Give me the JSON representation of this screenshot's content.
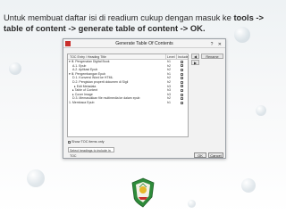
{
  "instruction": {
    "prefix": "Untuk membuat daftar isi di readium cukup dengan masuk ke ",
    "bold": "tools -> table of content -> generate table of content -> OK."
  },
  "dialog": {
    "title": "Generate Table Of Contents",
    "columns": {
      "title": "TOC Entry / Heading Title",
      "level": "Level",
      "include": "Include"
    },
    "rows": [
      {
        "title": "▾ Ill. Pengenalan Digital Book",
        "level": "h1",
        "checked": true,
        "indent": 0
      },
      {
        "title": "A.1. Epub",
        "level": "h2",
        "checked": true,
        "indent": 2
      },
      {
        "title": "A.2. Aplikasi Epub",
        "level": "h2",
        "checked": true,
        "indent": 2
      },
      {
        "title": "▾ Ill. Pengembangan Epub",
        "level": "h1",
        "checked": true,
        "indent": 0
      },
      {
        "title": "D.1. Konversi Word ke HTML",
        "level": "h2",
        "checked": true,
        "indent": 2
      },
      {
        "title": "D.2. Pengisian properti dokumen di Sigil",
        "level": "h2",
        "checked": true,
        "indent": 2
      },
      {
        "title": "▸ Edit Metadata",
        "level": "h3",
        "checked": true,
        "indent": 3
      },
      {
        "title": "▸ Table of Content",
        "level": "h3",
        "checked": true,
        "indent": 2
      },
      {
        "title": "▸ Cover Image",
        "level": "h3",
        "checked": true,
        "indent": 2
      },
      {
        "title": "D.3. Memasukkan file multimedia ke dalam epub",
        "level": "h2",
        "checked": true,
        "indent": 2
      },
      {
        "title": "1. Membaca Epub",
        "level": "h1",
        "checked": true,
        "indent": 0
      }
    ],
    "side_buttons": [
      "Rename"
    ],
    "show_toc_only_label": "Show TOC items only",
    "select_value": "Select headings to include in TOC",
    "ok_label": "OK",
    "cancel_label": "Cancel"
  },
  "colors": {
    "logo_green": "#2e8b3a",
    "logo_gold": "#e6b82a"
  }
}
